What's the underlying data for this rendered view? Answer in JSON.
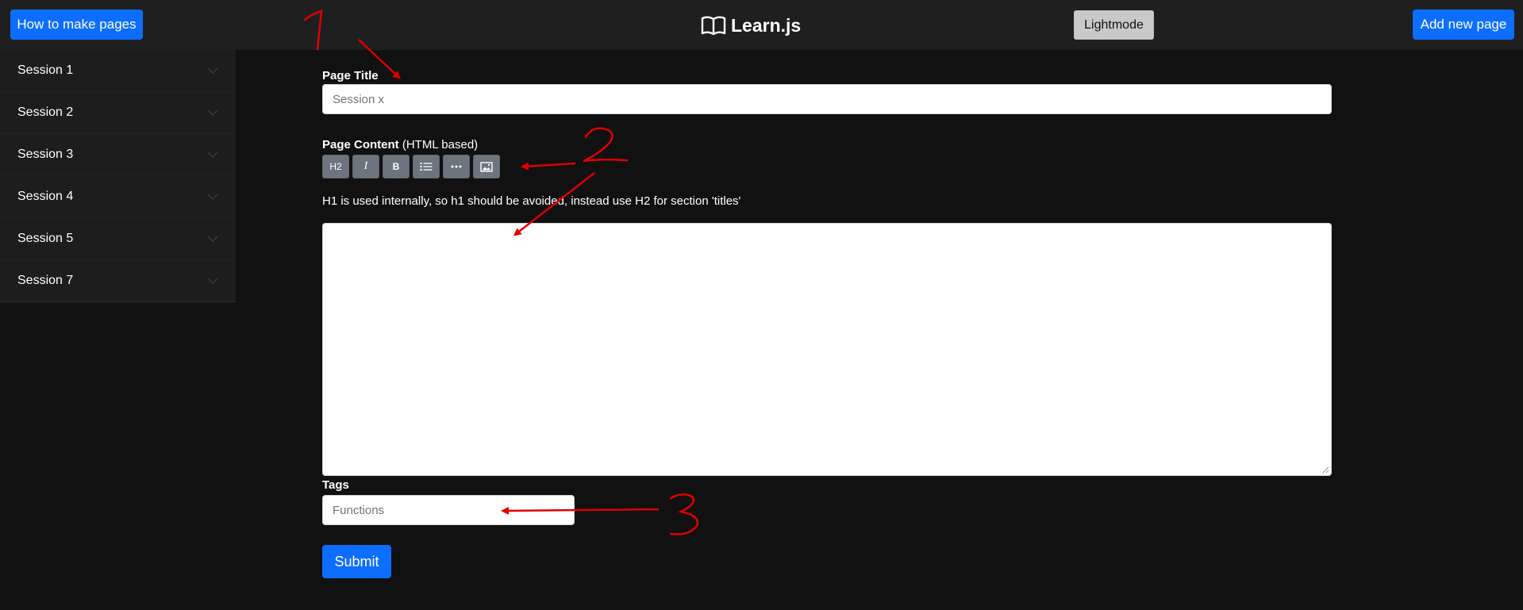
{
  "navbar": {
    "howto_label": "How to make pages",
    "brand": "Learn.js",
    "theme_toggle_label": "Lightmode",
    "add_page_label": "Add new page"
  },
  "sidebar": {
    "items": [
      {
        "label": "Session 1"
      },
      {
        "label": "Session 2"
      },
      {
        "label": "Session 3"
      },
      {
        "label": "Session 4"
      },
      {
        "label": "Session 5"
      },
      {
        "label": "Session 7"
      }
    ]
  },
  "form": {
    "title_label": "Page Title",
    "title_placeholder": "Session x",
    "content_label": "Page Content",
    "content_label_note": "(HTML based)",
    "toolbar": [
      {
        "label": "H2",
        "icon": "h2"
      },
      {
        "label": "I",
        "icon": "italic-icon"
      },
      {
        "label": "B",
        "icon": "bold-icon"
      },
      {
        "label": "",
        "icon": "list-icon"
      },
      {
        "label": "",
        "icon": "more-icon"
      },
      {
        "label": "",
        "icon": "image-icon"
      }
    ],
    "hint": "H1 is used internally, so h1 should be avoided, instead use H2 for section 'titles'",
    "content_value": "",
    "tags_label": "Tags",
    "tags_placeholder": "Functions",
    "submit_label": "Submit"
  },
  "annotations": {
    "color": "#e00000",
    "marks": [
      "1",
      "2",
      "3"
    ]
  },
  "colors": {
    "background": "#111111",
    "navbar": "#1f1f1f",
    "primary": "#0d6efd",
    "toolbar_button": "#6c757d"
  }
}
